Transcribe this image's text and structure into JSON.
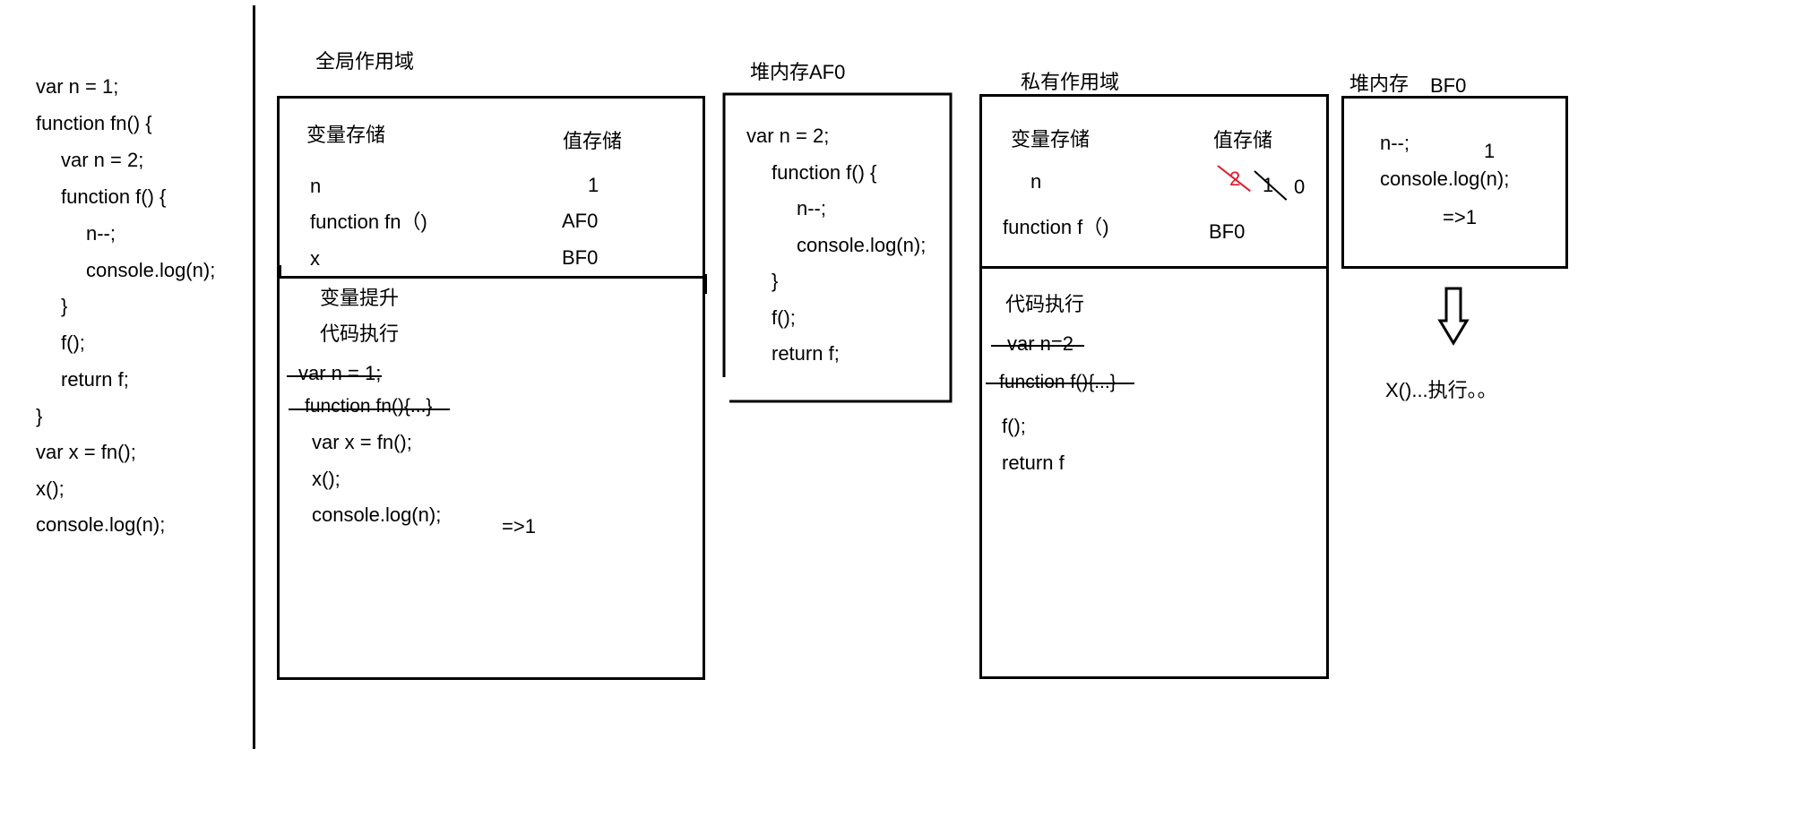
{
  "source_code": [
    "var n = 1;",
    "function fn() {",
    "var n = 2;",
    "function f() {",
    "n--;",
    "console.log(n);",
    "}",
    "f();",
    "return f;",
    "}",
    "var x = fn();",
    "x();",
    "console.log(n);"
  ],
  "global_scope": {
    "title": "全局作用域",
    "var_header": "变量存储",
    "val_header": "值存储",
    "vars": [
      {
        "name": "n",
        "value": "1"
      },
      {
        "name": "function fn（)",
        "value": "AF0"
      },
      {
        "name": "x",
        "value": "BF0"
      }
    ],
    "hoisting_label": "变量提升",
    "exec_label": "代码执行",
    "struck_lines": [
      "var n  = 1;",
      "function fn(){...}"
    ],
    "exec_lines": [
      "var x = fn();",
      "x();",
      "console.log(n);"
    ],
    "output": "=>1"
  },
  "heap_af0": {
    "title": "堆内存AF0",
    "lines": [
      "var n = 2;",
      "function f() {",
      "n--;",
      "console.log(n);",
      "}",
      "f();",
      "return f;"
    ]
  },
  "private_scope": {
    "title": "私有作用域",
    "var_header": "变量存储",
    "val_header": "值存储",
    "var_n": "n",
    "n_values": [
      "2",
      "1",
      "0"
    ],
    "var_f": "function f（)",
    "f_value": "BF0",
    "exec_label": "代码执行",
    "struck_lines": [
      "var n=2",
      "function f(){...}"
    ],
    "exec_lines": [
      "f();",
      "return f"
    ]
  },
  "heap_bf0": {
    "title": "堆内存",
    "address": "BF0",
    "lines": [
      "n--;",
      "console.log(n);"
    ],
    "n_note": "1",
    "output": "=>1"
  },
  "footer_note": "X()...执行。。",
  "colors": {
    "ink": "#000000",
    "correction": "#e0192b"
  }
}
